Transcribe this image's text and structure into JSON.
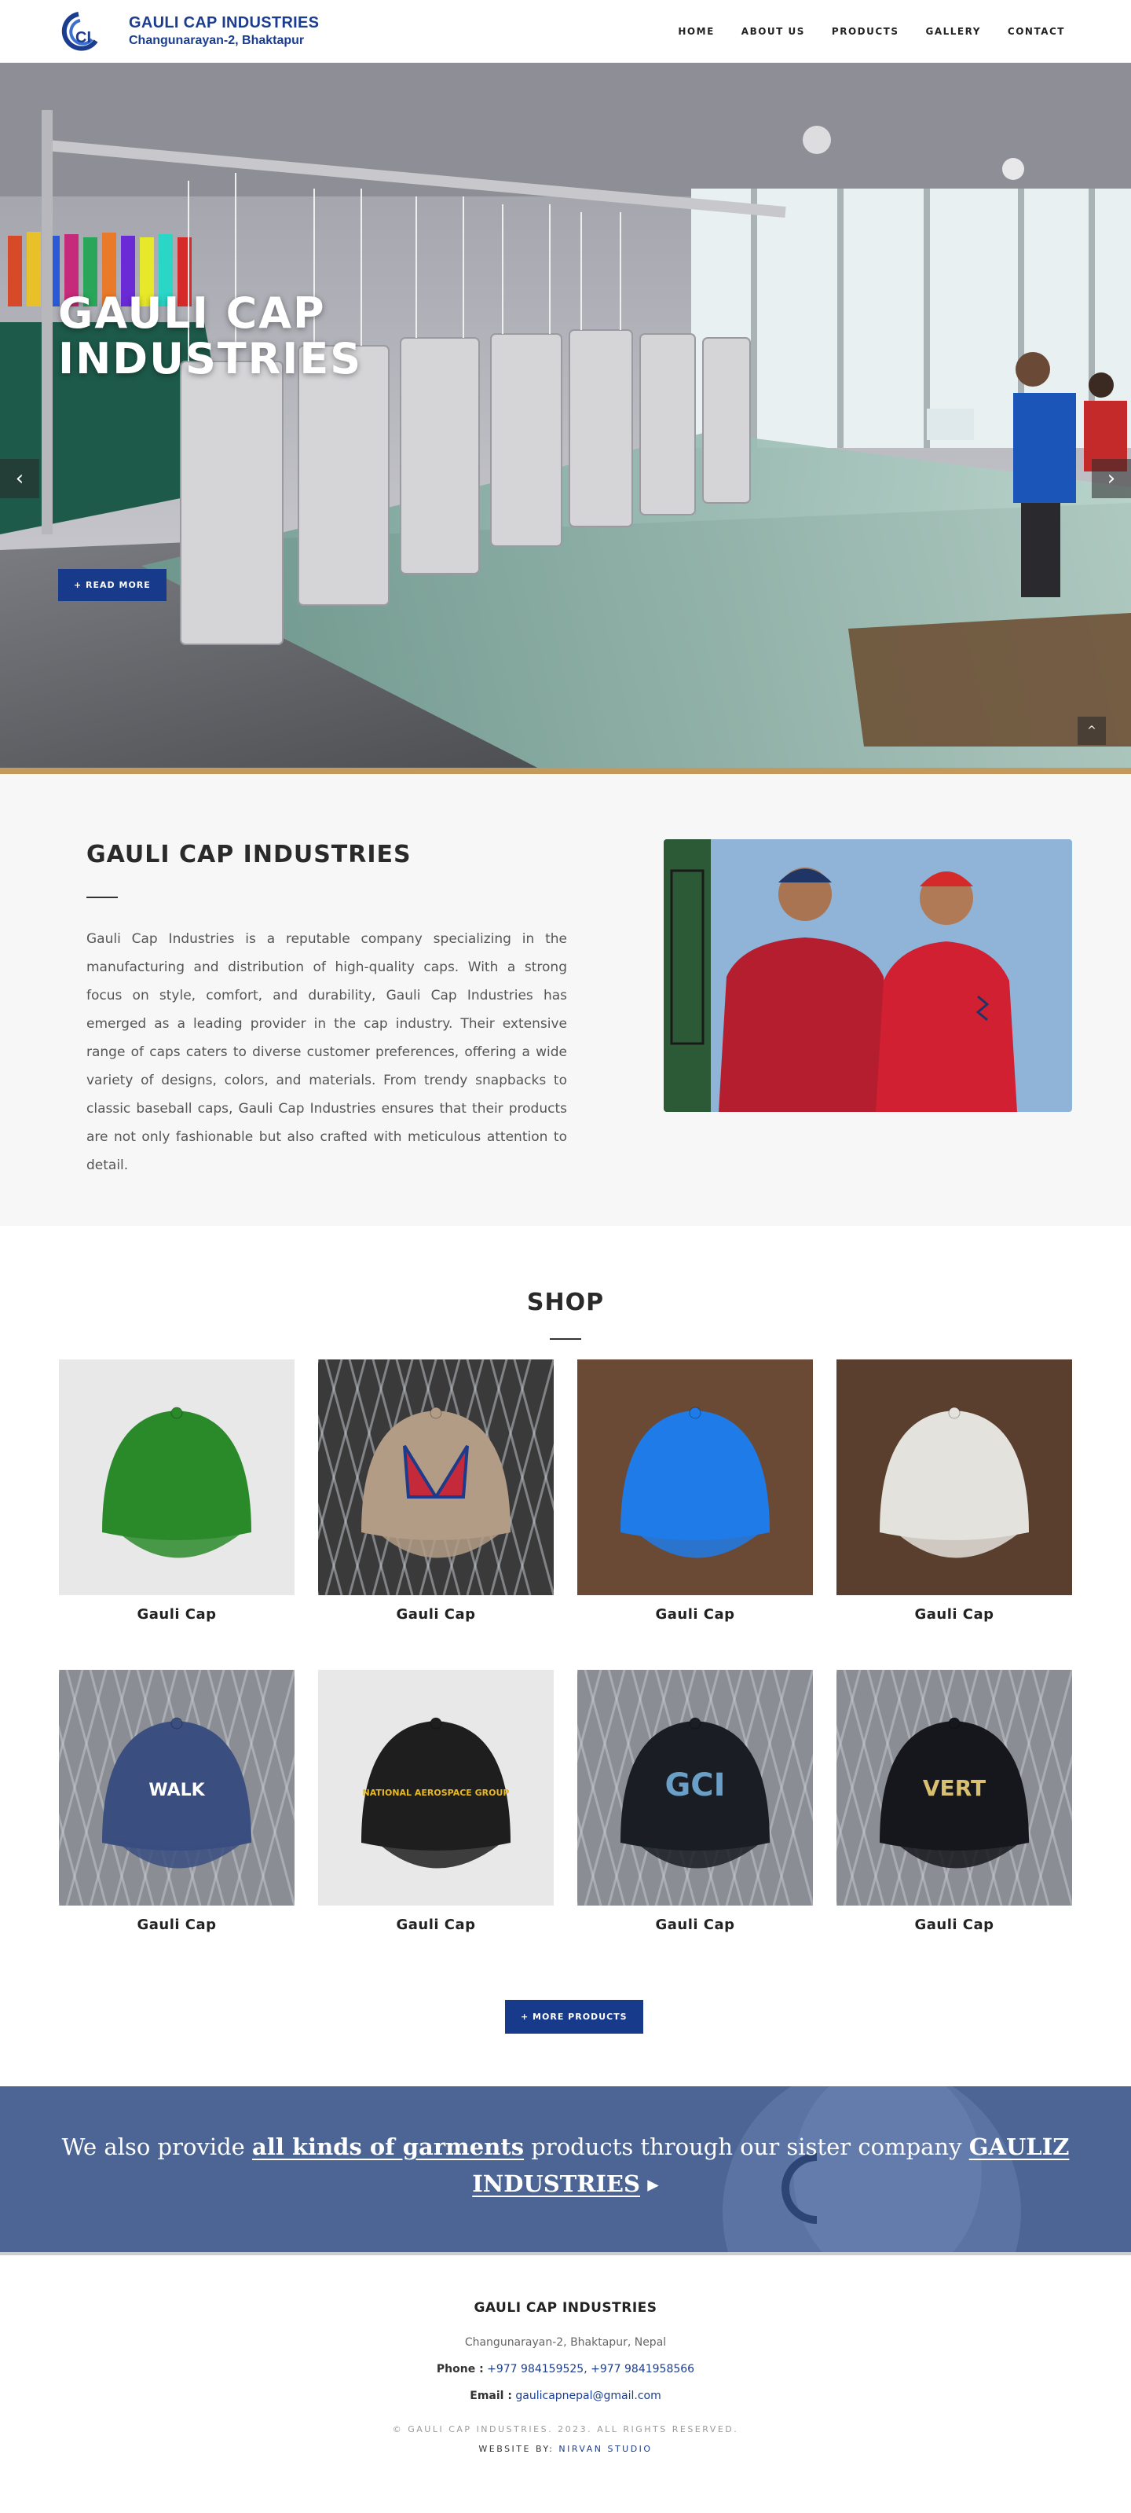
{
  "header": {
    "brand_name": "GAULI CAP INDUSTRIES",
    "brand_address": "Changunarayan-2, Bhaktapur",
    "nav": [
      "HOME",
      "ABOUT US",
      "PRODUCTS",
      "GALLERY",
      "CONTACT"
    ]
  },
  "hero": {
    "title": "GAULI CAP\nINDUSTRIES",
    "button": "+ READ MORE",
    "prev_icon": "‹",
    "next_icon": "›",
    "scroll_top_icon": "^"
  },
  "about": {
    "heading": "GAULI CAP INDUSTRIES",
    "body": "Gauli Cap Industries is a reputable company specializing in the manufacturing and distribution of high-quality caps. With a strong focus on style, comfort, and durability, Gauli Cap Industries has emerged as a leading provider in the cap industry. Their extensive range of caps caters to diverse customer preferences, offering a wide variety of designs, colors, and materials. From trendy snapbacks to classic baseball caps, Gauli Cap Industries ensures that their products are not only fashionable but also crafted with meticulous attention to detail."
  },
  "shop": {
    "heading": "SHOP",
    "products": [
      {
        "name": "Gauli Cap",
        "cap_color": "#2a8a2a",
        "bg": "#e8e8e8",
        "emblem": "none"
      },
      {
        "name": "Gauli Cap",
        "cap_color": "#b39c86",
        "bg": "#3a3a3a",
        "emblem": "flag"
      },
      {
        "name": "Gauli Cap",
        "cap_color": "#1e7be8",
        "bg": "#6b4a35",
        "emblem": "none"
      },
      {
        "name": "Gauli Cap",
        "cap_color": "#e4e2dc",
        "bg": "#5a3f2e",
        "emblem": "none"
      },
      {
        "name": "Gauli Cap",
        "cap_color": "#3a4e80",
        "bg": "#8a8e94",
        "emblem": "walk",
        "emblem_text": "WALK"
      },
      {
        "name": "Gauli Cap",
        "cap_color": "#1e1e1e",
        "bg": "#e8e8e8",
        "emblem": "nasg",
        "emblem_text": "NATIONAL AEROSPACE GROUP"
      },
      {
        "name": "Gauli Cap",
        "cap_color": "#1a1d24",
        "bg": "#8a8e94",
        "emblem": "gci",
        "emblem_text": "GCI"
      },
      {
        "name": "Gauli Cap",
        "cap_color": "#15171c",
        "bg": "#8a8e94",
        "emblem": "vert",
        "emblem_text": "VERT"
      }
    ],
    "more_button": "+ MORE PRODUCTS"
  },
  "banner": {
    "prefix": "We also provide ",
    "link_garments": "all kinds of garments",
    "middle": " products through our sister company ",
    "link_company_a": "GAULIZ",
    "link_company_b": "INDUSTRIES",
    "arrow_icon": "▸"
  },
  "footer": {
    "name": "GAULI CAP INDUSTRIES",
    "address": "Changunarayan-2, Bhaktapur, Nepal",
    "phone_label": "Phone :",
    "phone_value": "+977 984159525, +977 9841958566",
    "email_label": "Email :",
    "email_value": "gaulicapnepal@gmail.com",
    "copyright": "© GAULI CAP INDUSTRIES. 2023. ALL RIGHTS RESERVED.",
    "credit_prefix": "WEBSITE BY:",
    "credit_link": "NIRVAN STUDIO"
  },
  "colors": {
    "brand_blue": "#1b3d8f",
    "button_blue": "#173a8a",
    "banner_bg": "#4c6594",
    "hero_border": "#c49a5c"
  }
}
